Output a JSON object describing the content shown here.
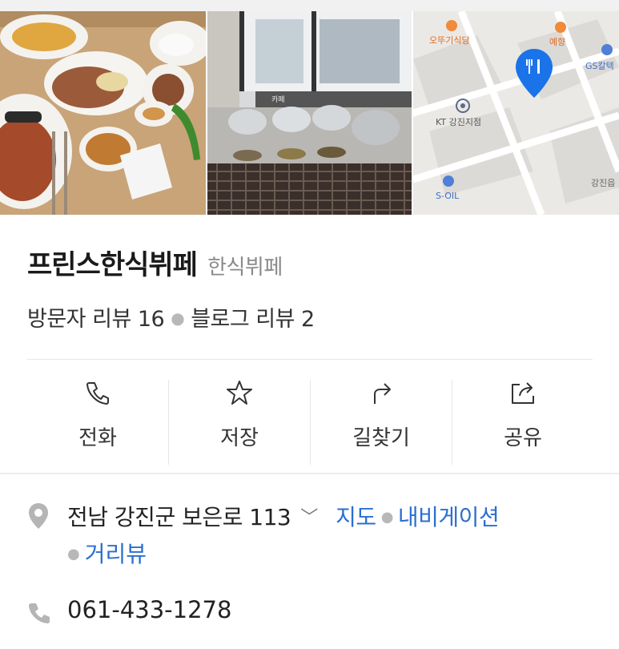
{
  "photos": {
    "map_labels": {
      "restaurant_1": "오뚜기식당",
      "restaurant_2": "예향",
      "gas_station_1": "GS칼텍",
      "kt_branch": "KT 강진지점",
      "gas_station_2": "S-OIL",
      "area": "강진읍",
      "photo2_sign": "카페"
    }
  },
  "place": {
    "name": "프린스한식뷔페",
    "category": "한식뷔페",
    "visitor_reviews": "방문자 리뷰 16",
    "blog_reviews": "블로그 리뷰 2"
  },
  "actions": [
    {
      "label": "전화",
      "icon": "phone-icon"
    },
    {
      "label": "저장",
      "icon": "star-icon"
    },
    {
      "label": "길찾기",
      "icon": "directions-icon"
    },
    {
      "label": "공유",
      "icon": "share-icon"
    }
  ],
  "address": {
    "text": "전남 강진군 보은로 113",
    "map_link": "지도",
    "navigation_link": "내비게이션",
    "street_view_link": "거리뷰"
  },
  "phone": {
    "number": "061-433-1278"
  },
  "colors": {
    "link": "#2b6fcf",
    "map_pin": "#1a73e8",
    "icon_gray": "#b5b5b5"
  }
}
